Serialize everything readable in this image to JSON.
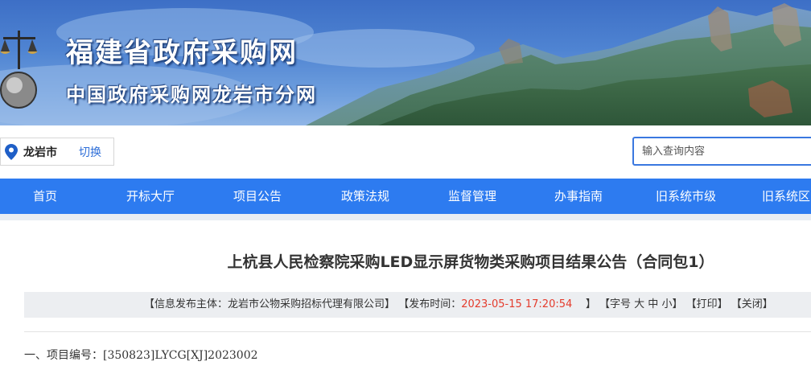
{
  "header": {
    "site_title": "福建省政府采购网",
    "site_subtitle": "中国政府采购网龙岩市分网"
  },
  "location": {
    "city": "龙岩市",
    "switch_label": "切换"
  },
  "search": {
    "placeholder": "输入查询内容"
  },
  "nav": {
    "items": [
      {
        "label": "首页"
      },
      {
        "label": "开标大厅"
      },
      {
        "label": "项目公告"
      },
      {
        "label": "政策法规"
      },
      {
        "label": "监督管理"
      },
      {
        "label": "办事指南"
      },
      {
        "label": "旧系统市级"
      },
      {
        "label": "旧系统区"
      }
    ]
  },
  "article": {
    "title": "上杭县人民检察院采购LED显示屏货物类采购项目结果公告（合同包1）",
    "meta": {
      "publisher_prefix": "【信息发布主体：",
      "publisher": "龙岩市公物采购招标代理有限公司",
      "publisher_suffix": "】",
      "time_prefix": "【发布时间：",
      "time": "2023-05-15 17:20:54",
      "time_suffix": "】",
      "font_size_prefix": "【字号",
      "font_large": "大",
      "font_medium": "中",
      "font_small": "小",
      "font_size_suffix": "】",
      "print": "【打印】",
      "close": "【关闭】"
    },
    "section_1": "一、项目编号：[350823]LYCG[XJ]2023002"
  },
  "colors": {
    "nav_blue": "#2d7bf0",
    "link_blue": "#2f6fd8",
    "time_red": "#e43b2c"
  }
}
